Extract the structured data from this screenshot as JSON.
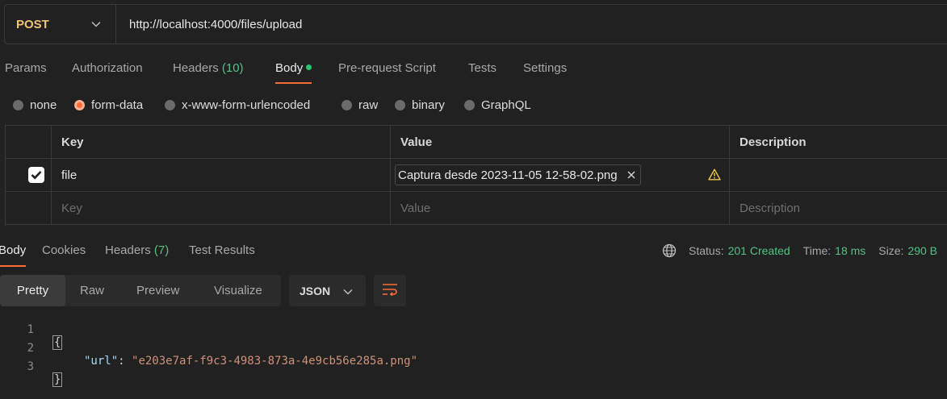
{
  "request": {
    "method": "POST",
    "url": "http://localhost:4000/files/upload"
  },
  "request_tabs": {
    "params": "Params",
    "authorization": "Authorization",
    "headers": "Headers",
    "headers_count": "(10)",
    "body": "Body",
    "prerequest": "Pre-request Script",
    "tests": "Tests",
    "settings": "Settings"
  },
  "body_types": {
    "none": "none",
    "form_data": "form-data",
    "urlencoded": "x-www-form-urlencoded",
    "raw": "raw",
    "binary": "binary",
    "graphql": "GraphQL",
    "selected": "form-data"
  },
  "form_table": {
    "headers": {
      "key": "Key",
      "value": "Value",
      "description": "Description"
    },
    "rows": [
      {
        "checked": true,
        "key": "file",
        "value": "Captura desde 2023-11-05 12-58-02.png",
        "description": ""
      }
    ],
    "placeholder": {
      "key": "Key",
      "value": "Value",
      "description": "Description"
    }
  },
  "response_tabs": {
    "body": "Body",
    "cookies": "Cookies",
    "headers": "Headers",
    "headers_count": "(7)",
    "test_results": "Test Results"
  },
  "response_status": {
    "status_label": "Status:",
    "status_value": "201 Created",
    "time_label": "Time:",
    "time_value": "18 ms",
    "size_label": "Size:",
    "size_value": "290 B"
  },
  "response_view": {
    "pretty": "Pretty",
    "raw": "Raw",
    "preview": "Preview",
    "visualize": "Visualize",
    "format": "JSON"
  },
  "response_body": {
    "lines": [
      "1",
      "2",
      "3"
    ],
    "open_brace": "{",
    "close_brace": "}",
    "key": "\"url\"",
    "colon": ": ",
    "value": "\"e203e7af-f9c3-4983-873a-4e9cb56e285a.png\""
  },
  "colors": {
    "accent": "#ff6c37",
    "success": "#55c082",
    "method": "#f0c674",
    "background": "#212121"
  }
}
